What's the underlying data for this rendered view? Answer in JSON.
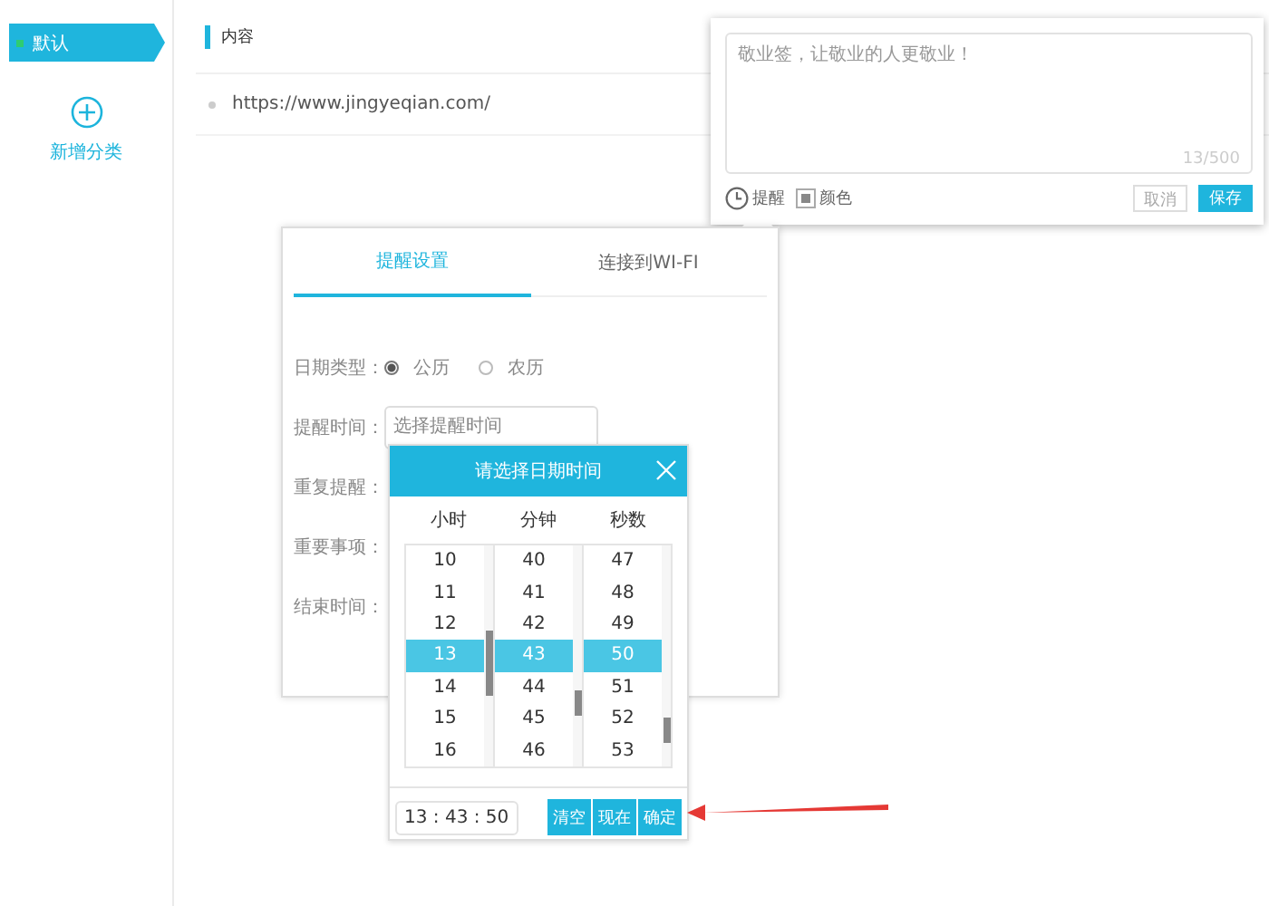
{
  "sidebar": {
    "categories": [
      {
        "label": "默认",
        "selected": true,
        "color": "#2ecc71"
      }
    ],
    "add_button": "新增分类"
  },
  "content": {
    "header": "内容",
    "items": [
      "https://www.jingyeqian.com/"
    ]
  },
  "note_editor": {
    "value": "敬业签，让敬业的人更敬业！",
    "counter": "13/500",
    "tools": [
      {
        "kind": "clock",
        "label": "提醒"
      },
      {
        "kind": "color",
        "label": "颜色"
      }
    ],
    "cancel": "取消",
    "save": "保存"
  },
  "reminder_dialog": {
    "tabs": [
      {
        "label": "提醒设置",
        "selected": true
      },
      {
        "label": "连接到WI-FI",
        "selected": false
      }
    ],
    "date_type": {
      "label": "日期类型：",
      "options": [
        {
          "label": "公历",
          "selected": true
        },
        {
          "label": "农历",
          "selected": false
        }
      ]
    },
    "time_field": {
      "label": "提醒时间：",
      "placeholder": "选择提醒时间"
    },
    "other_labels": [
      "重复提醒：",
      "重要事项：",
      "结束时间："
    ]
  },
  "time_picker": {
    "title": "请选择日期时间",
    "columns": [
      {
        "heading": "小时",
        "values": [
          {
            "text": "10",
            "selected": false
          },
          {
            "text": "11",
            "selected": false
          },
          {
            "text": "12",
            "selected": false
          },
          {
            "text": "13",
            "selected": true
          },
          {
            "text": "14",
            "selected": false
          },
          {
            "text": "15",
            "selected": false
          },
          {
            "text": "16",
            "selected": false
          }
        ]
      },
      {
        "heading": "分钟",
        "values": [
          {
            "text": "40",
            "selected": false
          },
          {
            "text": "41",
            "selected": false
          },
          {
            "text": "42",
            "selected": false
          },
          {
            "text": "43",
            "selected": true
          },
          {
            "text": "44",
            "selected": false
          },
          {
            "text": "45",
            "selected": false
          },
          {
            "text": "46",
            "selected": false
          }
        ]
      },
      {
        "heading": "秒数",
        "values": [
          {
            "text": "47",
            "selected": false
          },
          {
            "text": "48",
            "selected": false
          },
          {
            "text": "49",
            "selected": false
          },
          {
            "text": "50",
            "selected": true
          },
          {
            "text": "51",
            "selected": false
          },
          {
            "text": "52",
            "selected": false
          },
          {
            "text": "53",
            "selected": false
          }
        ]
      }
    ],
    "value": "13 : 43 : 50",
    "buttons": [
      "清空",
      "现在",
      "确定"
    ]
  }
}
